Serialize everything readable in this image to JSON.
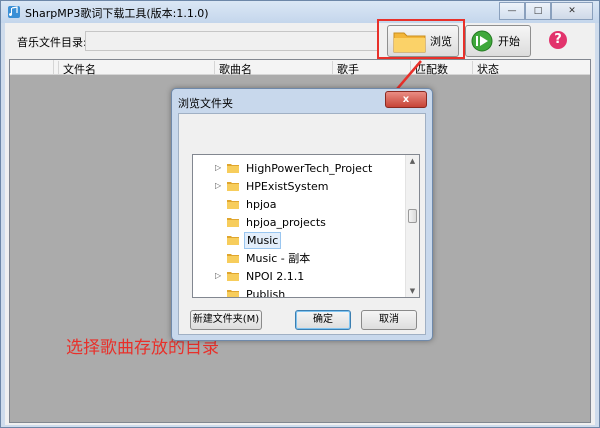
{
  "window": {
    "title": "SharpMP3歌词下载工具(版本:1.1.0)",
    "controls": [
      "—",
      "□",
      "✕"
    ]
  },
  "toolbar": {
    "dir_label": "音乐文件目录:",
    "dir_value": "",
    "browse_label": "浏览",
    "start_label": "开始",
    "help_glyph": "?"
  },
  "grid": {
    "columns": [
      "文件名",
      "歌曲名",
      "歌手",
      "匹配数",
      "状态"
    ]
  },
  "dialog": {
    "title": "浏览文件夹",
    "close_glyph": "x",
    "tree": [
      {
        "label": "HighPowerTech_Project",
        "expandable": true,
        "selected": false
      },
      {
        "label": "HPExistSystem",
        "expandable": true,
        "selected": false
      },
      {
        "label": "hpjoa",
        "expandable": false,
        "selected": false
      },
      {
        "label": "hpjoa_projects",
        "expandable": false,
        "selected": false
      },
      {
        "label": "Music",
        "expandable": false,
        "selected": true
      },
      {
        "label": "Music - 副本",
        "expandable": false,
        "selected": false
      },
      {
        "label": "NPOI 2.1.1",
        "expandable": true,
        "selected": false
      },
      {
        "label": "Publish",
        "expandable": false,
        "selected": false
      }
    ],
    "new_folder_label": "新建文件夹(M)",
    "ok_label": "确定",
    "cancel_label": "取消"
  },
  "annotation": "选择歌曲存放的目录",
  "colors": {
    "highlight": "#e8302a",
    "help_icon": "#e2336c",
    "grid_background": "#ababab"
  }
}
